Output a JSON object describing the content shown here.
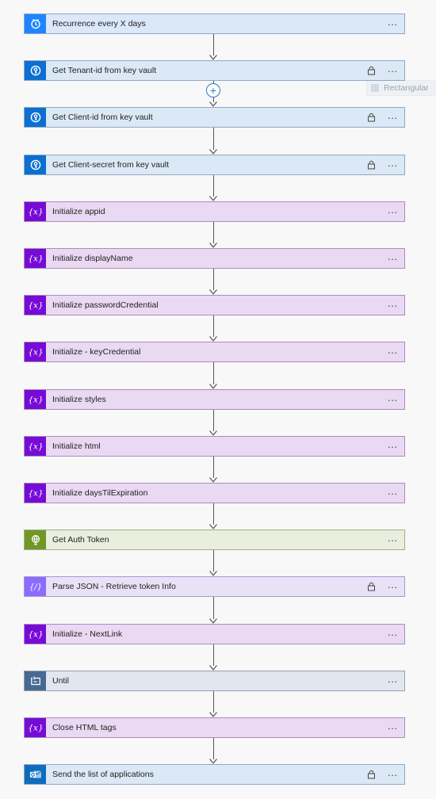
{
  "steps": [
    {
      "title": "Recurrence every X days",
      "type": "recurrence",
      "icon": "clock-icon",
      "locked": false
    },
    {
      "title": "Get Tenant-id from key vault",
      "type": "keyvault",
      "icon": "key-vault-icon",
      "locked": true
    },
    {
      "title": "Get Client-id from key vault",
      "type": "keyvault",
      "icon": "key-vault-icon",
      "locked": true
    },
    {
      "title": "Get Client-secret from key vault",
      "type": "keyvault",
      "icon": "key-vault-icon",
      "locked": true
    },
    {
      "title": "Initialize appid",
      "type": "variable",
      "icon": "variable-icon",
      "locked": false
    },
    {
      "title": "Initialize displayName",
      "type": "variable",
      "icon": "variable-icon",
      "locked": false
    },
    {
      "title": "Initialize passwordCredential",
      "type": "variable",
      "icon": "variable-icon",
      "locked": false
    },
    {
      "title": "Initialize - keyCredential",
      "type": "variable",
      "icon": "variable-icon",
      "locked": false
    },
    {
      "title": "Initialize styles",
      "type": "variable",
      "icon": "variable-icon",
      "locked": false
    },
    {
      "title": "Initialize html",
      "type": "variable",
      "icon": "variable-icon",
      "locked": false
    },
    {
      "title": "Initialize daysTilExpiration",
      "type": "variable",
      "icon": "variable-icon",
      "locked": false
    },
    {
      "title": "Get Auth Token",
      "type": "http",
      "icon": "globe-icon",
      "locked": false
    },
    {
      "title": "Parse JSON - Retrieve token Info",
      "type": "json",
      "icon": "parse-json-icon",
      "locked": true
    },
    {
      "title": "Initialize - NextLink",
      "type": "variable",
      "icon": "variable-icon",
      "locked": false
    },
    {
      "title": "Until",
      "type": "until",
      "icon": "loop-icon",
      "locked": false
    },
    {
      "title": "Close HTML tags",
      "type": "variable",
      "icon": "variable-icon",
      "locked": false
    },
    {
      "title": "Send the list of applications",
      "type": "mail",
      "icon": "outlook-icon",
      "locked": true
    }
  ],
  "more_label": "···",
  "ghost_label": "Rectangular",
  "insert_label": "+",
  "colors": {
    "connector": "#555555",
    "insert_accent": "#2b79c9"
  }
}
